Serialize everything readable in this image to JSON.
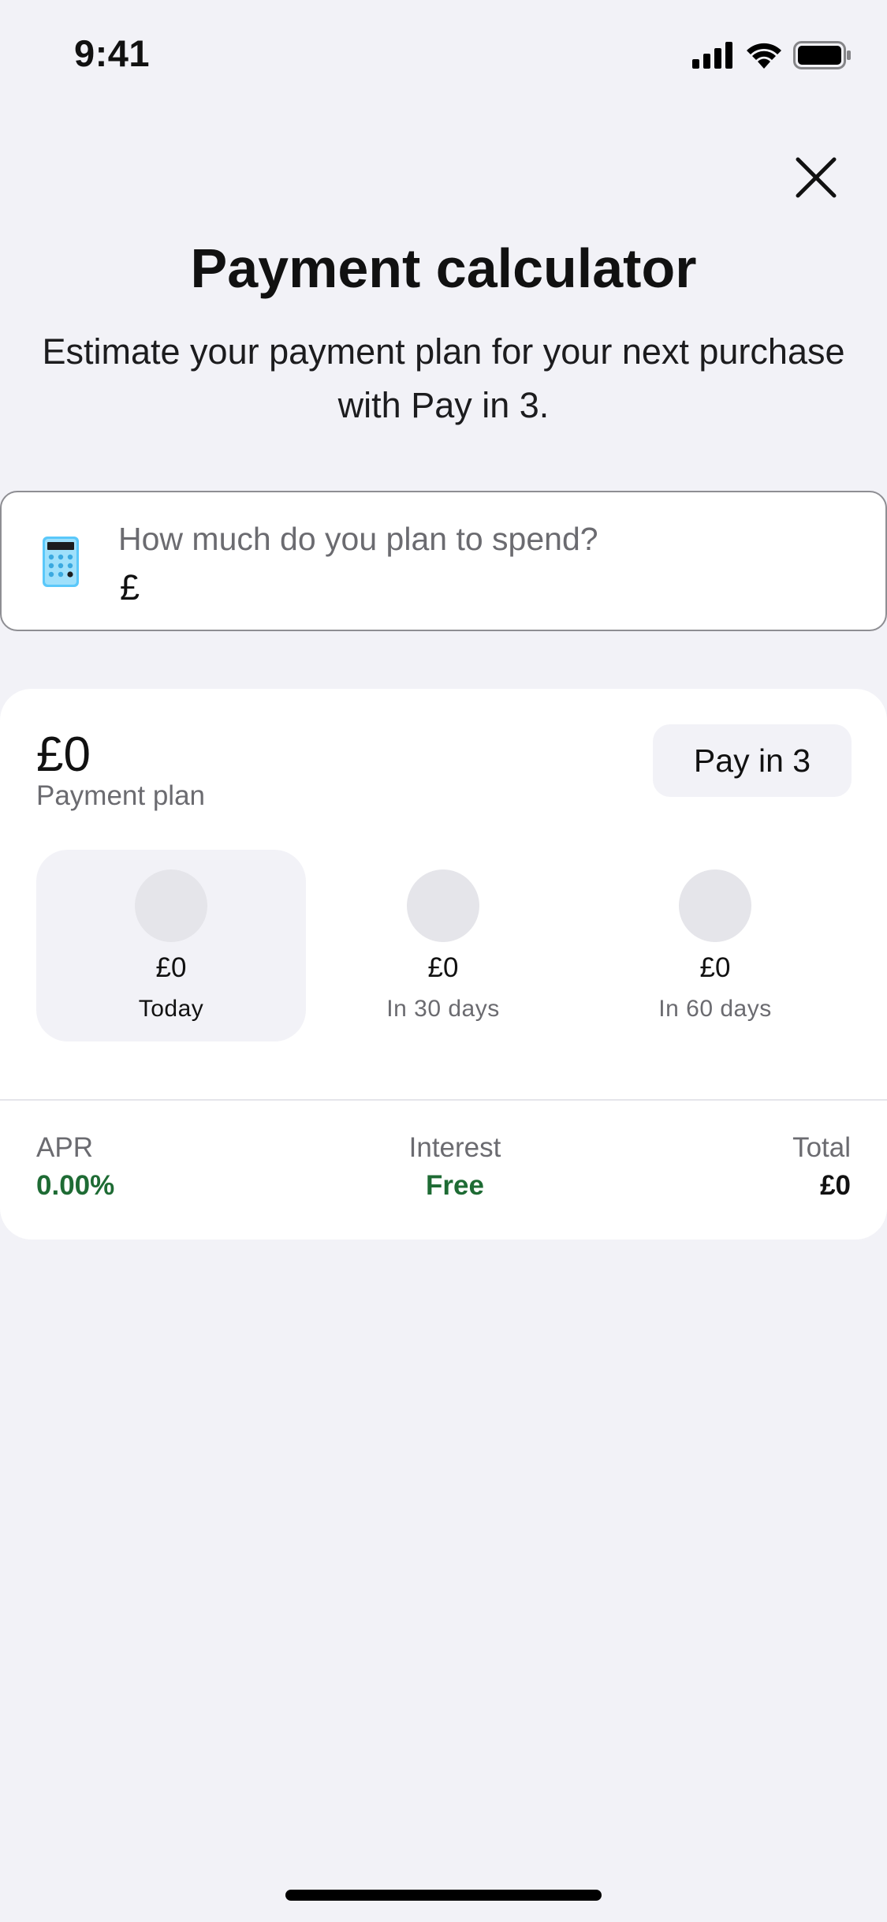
{
  "status_bar": {
    "time": "9:41"
  },
  "header": {
    "title": "Payment calculator",
    "subtitle_line1": "Estimate your payment plan for your next purchase",
    "subtitle_line2": "with Pay in 3."
  },
  "amount_input": {
    "label": "How much do you plan to spend?",
    "currency": "£",
    "value": "",
    "icon": "calculator-icon"
  },
  "plan": {
    "total": "£0",
    "label": "Payment plan",
    "plan_button": "Pay in 3",
    "installments": [
      {
        "amount": "£0",
        "when": "Today"
      },
      {
        "amount": "£0",
        "when": "In 30 days"
      },
      {
        "amount": "£0",
        "when": "In 60 days"
      }
    ],
    "summary": {
      "apr_label": "APR",
      "apr_value": "0.00%",
      "interest_label": "Interest",
      "interest_value": "Free",
      "total_label": "Total",
      "total_value": "£0"
    }
  },
  "colors": {
    "background": "#f2f2f7",
    "accent_green": "#1e6b34",
    "text": "#111111",
    "secondary_text": "#6b6b70"
  }
}
